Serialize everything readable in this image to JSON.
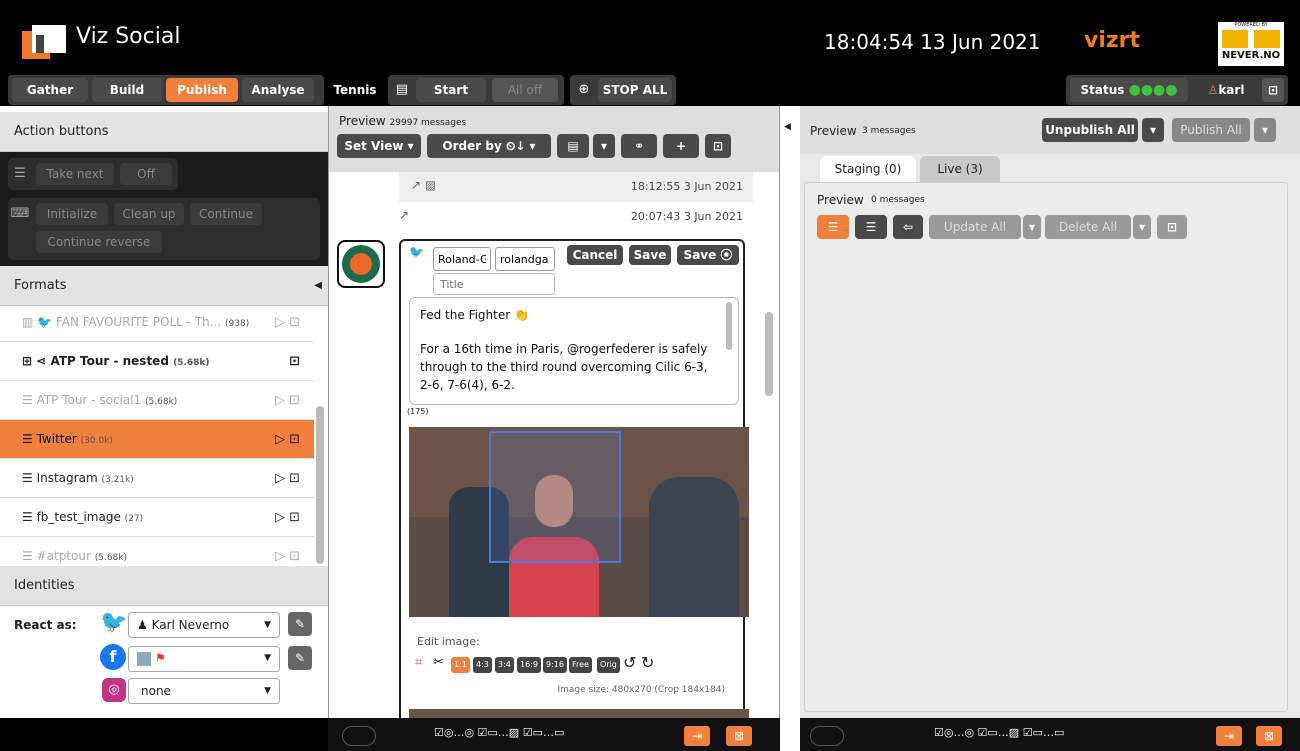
{
  "app": {
    "title": "Viz Social",
    "clock": "18:04:54 13 Jun 2021",
    "vizrt": "vizrt",
    "brand_top": "POWERED BY",
    "brand": "NEVER.NO"
  },
  "nav": {
    "gather": "Gather",
    "build": "Build",
    "publish": "Publish",
    "analyse": "Analyse",
    "tennis": "Tennis",
    "start": "Start",
    "all_off": "All off",
    "stop_all": "STOP ALL",
    "status": "Status",
    "user": "karl"
  },
  "left": {
    "action_buttons_title": "Action buttons",
    "take_next": "Take next",
    "off": "Off",
    "initialize": "Initialize",
    "clean_up": "Clean up",
    "continue": "Continue",
    "continue_reverse": "Continue reverse",
    "formats_title": "Formats",
    "formats": [
      {
        "name": "FAN FAVOURITE POLL - Th...",
        "count": "(938)"
      },
      {
        "name": "ATP Tour - nested",
        "count": "(5.68k)"
      },
      {
        "name": "ATP Tour - social1",
        "count": "(5.68k)"
      },
      {
        "name": "Twitter",
        "count": "(30.0k)"
      },
      {
        "name": "Instagram",
        "count": "(3.21k)"
      },
      {
        "name": "fb_test_image",
        "count": "(27)"
      },
      {
        "name": "#atptour",
        "count": "(5.68k)"
      }
    ],
    "identities_title": "Identities",
    "react_as": "React as:",
    "twitter_identity": "Karl Neverno",
    "instagram_identity": "none"
  },
  "middle": {
    "preview": "Preview",
    "messages": "29997 messages",
    "set_view": "Set View",
    "order_by": "Order by",
    "card1_time": "18:12:55 3 Jun 2021",
    "card2_time": "20:07:43 3 Jun 2021",
    "field1": "Roland-G",
    "field2": "rolandga",
    "title_placeholder": "Title",
    "cancel": "Cancel",
    "save": "Save",
    "save2": "Save",
    "text_title": "Fed the Fighter 👏",
    "text_body": "For a 16th time in Paris, @rogerfederer is safely through to the third round overcoming Cilic 6-3, 2-6, 7-6(4), 6-2.",
    "char_count": "(175)",
    "edit_image": "Edit image:",
    "ratios": [
      "1:1",
      "4:3",
      "3:4",
      "16:9",
      "9:16",
      "Free",
      "Orig"
    ],
    "image_size": "Image size: 480x270 (Crop 184x184)"
  },
  "right": {
    "preview": "Preview",
    "messages": "3 messages",
    "unpublish_all": "Unpublish All",
    "publish_all": "Publish All",
    "tab_staging": "Staging (0)",
    "tab_live": "Live (3)",
    "inner_preview": "Preview",
    "inner_messages": "0 messages",
    "update_all": "Update All",
    "delete_all": "Delete All"
  },
  "colors": {
    "accent": "#f0803c",
    "status_green": "#3ec13e"
  }
}
